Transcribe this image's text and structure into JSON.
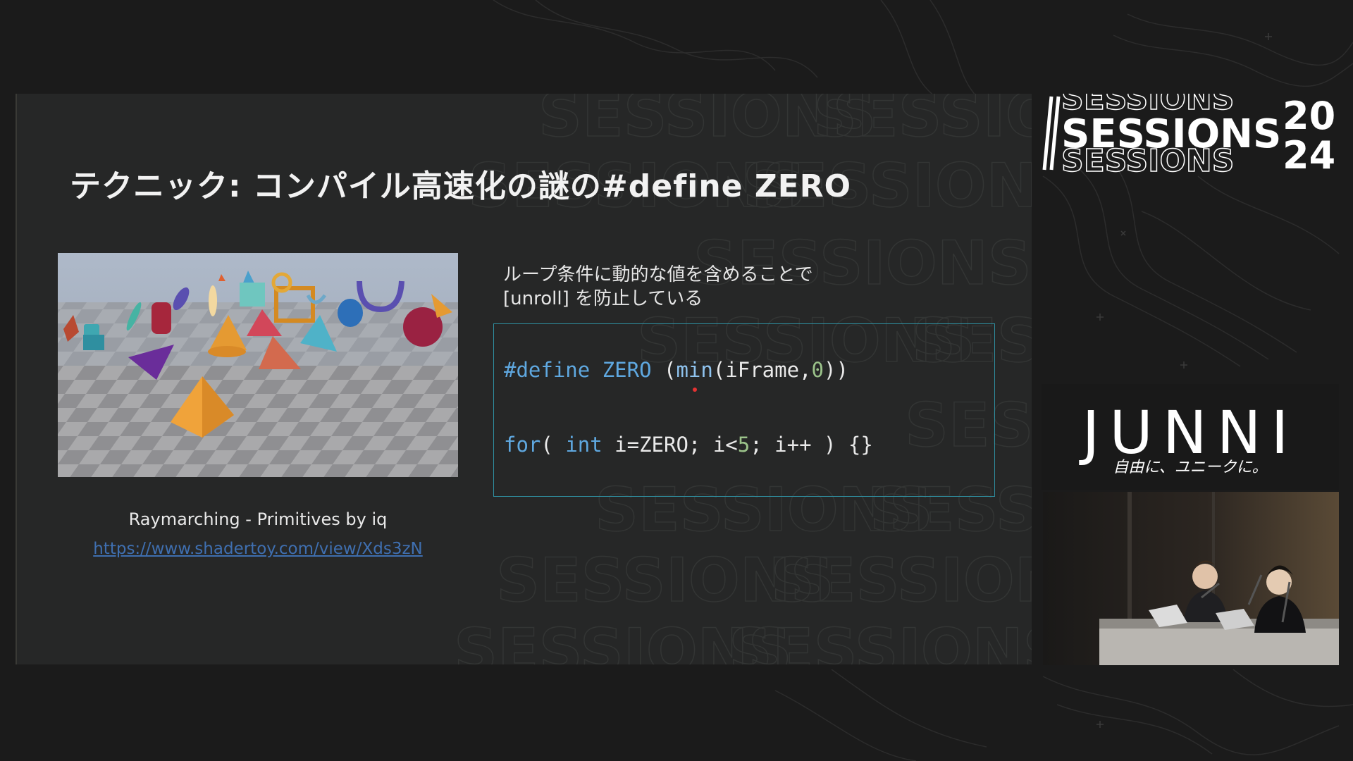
{
  "slide": {
    "title": "テクニック: コンパイル高速化の謎の#define ZERO",
    "image_caption": "Raymarching - Primitives by iq",
    "image_link": "https://www.shadertoy.com/view/Xds3zN",
    "description": "ループ条件に動的な値を含めることで\n[unroll] を防止している",
    "watermark_word": "SESSIONS"
  },
  "code": {
    "line1": {
      "directive": "#define",
      "name": "ZERO",
      "open": " (",
      "fn": "min",
      "args": "(iFrame,",
      "zero": "0",
      "close": "))"
    },
    "line2": {
      "kw_for": "for",
      "p1": "( ",
      "kw_int": "int",
      "p2": " i=ZERO; i<",
      "num": "5",
      "p3": "; i++ ) {}"
    }
  },
  "branding": {
    "event_logo": "SESSIONS",
    "event_year_top": "20",
    "event_year_bottom": "24",
    "sponsor": "JUNNI",
    "sponsor_tagline": "自由に、ユニークに。"
  },
  "colors": {
    "background": "#1b1b1b",
    "slide_bg": "#262727",
    "code_border": "#2f8fa0",
    "keyword": "#5fa8e0",
    "link": "#3f6fb0"
  }
}
